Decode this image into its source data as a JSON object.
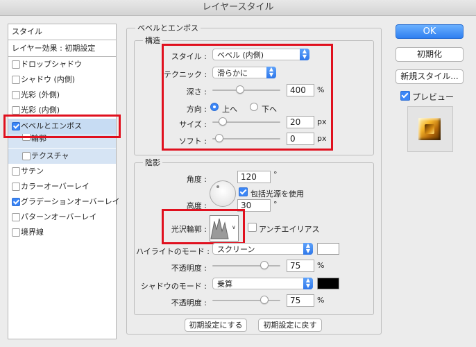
{
  "window": {
    "title": "レイヤースタイル"
  },
  "style_list": {
    "header": "スタイル",
    "defaults_item": "レイヤー効果 : 初期設定",
    "items": [
      {
        "label": "ドロップシャドウ",
        "checked": false
      },
      {
        "label": "シャドウ (内側)",
        "checked": false
      },
      {
        "label": "光彩 (外側)",
        "checked": false
      },
      {
        "label": "光彩 (内側)",
        "checked": false
      },
      {
        "label": "ベベルとエンボス",
        "checked": true,
        "selected": true
      },
      {
        "label": "輪郭",
        "checked": false,
        "sub": true
      },
      {
        "label": "テクスチャ",
        "checked": false,
        "sub": true
      },
      {
        "label": "サテン",
        "checked": false
      },
      {
        "label": "カラーオーバーレイ",
        "checked": false
      },
      {
        "label": "グラデーションオーバーレイ",
        "checked": true
      },
      {
        "label": "パターンオーバーレイ",
        "checked": false
      },
      {
        "label": "境界線",
        "checked": false
      }
    ]
  },
  "bevel": {
    "section_title": "ベベルとエンボス",
    "structure": {
      "title": "構造",
      "style_label": "スタイル :",
      "style_value": "ベベル (内側)",
      "technique_label": "テクニック :",
      "technique_value": "滑らかに",
      "depth_label": "深さ :",
      "depth_value": "400",
      "depth_unit": "%",
      "depth_level": 0.45,
      "direction_label": "方向 :",
      "direction_up": "上へ",
      "direction_down": "下へ",
      "size_label": "サイズ :",
      "size_value": "20",
      "size_unit": "px",
      "soften_label": "ソフト :",
      "soften_value": "0",
      "soften_unit": "px"
    },
    "shading": {
      "title": "陰影",
      "angle_label": "角度 :",
      "angle_value": "120",
      "angle_unit": "°",
      "global_light_label": "包括光源を使用",
      "altitude_label": "高度 :",
      "altitude_value": "30",
      "altitude_unit": "°",
      "gloss_label": "光沢輪郭 :",
      "antialias_label": "アンチエイリアス",
      "highlight_mode_label": "ハイライトのモード :",
      "highlight_mode_value": "スクリーン",
      "highlight_color": "#ffffff",
      "highlight_opacity_label": "不透明度 :",
      "highlight_opacity_value": "75",
      "shadow_mode_label": "シャドウのモード :",
      "shadow_mode_value": "乗算",
      "shadow_color": "#000000",
      "shadow_opacity_label": "不透明度 :",
      "shadow_opacity_value": "75",
      "percent": "%"
    },
    "make_default": "初期設定にする",
    "reset_default": "初期設定に戻す"
  },
  "buttons": {
    "ok": "OK",
    "reset": "初期化",
    "new_style": "新規スタイル...",
    "preview": "プレビュー"
  },
  "colors": {
    "accent": "#2f7ff0",
    "highlight_box": "#e0101e",
    "selection": "#c7dcf3"
  }
}
